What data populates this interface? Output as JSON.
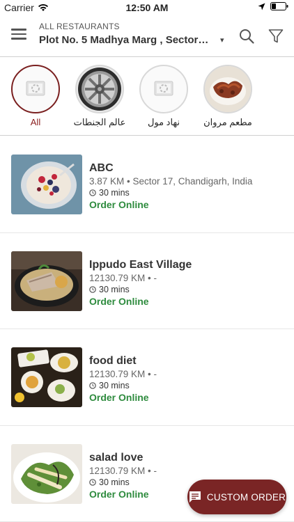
{
  "status_bar": {
    "carrier": "Carrier",
    "time": "12:50 AM"
  },
  "header": {
    "subtitle": "ALL RESTAURANTS",
    "location": "Plot No. 5 Madhya Marg , Sector…"
  },
  "categories": [
    {
      "label": "All",
      "icon": "placeholder-image-icon",
      "active": true
    },
    {
      "label": "عالم الجنطات",
      "icon": "wheel-rim-image"
    },
    {
      "label": "نهاد مول",
      "icon": "placeholder-image-icon"
    },
    {
      "label": "مطعم مروان",
      "icon": "food-plate-image"
    }
  ],
  "restaurants": [
    {
      "name": "ABC",
      "distance": "3.87 KM • Sector 17, Chandigarh, India",
      "time": "30 mins",
      "order": "Order Online",
      "image": "berry-bowl-photo"
    },
    {
      "name": "Ippudo East Village",
      "distance": "12130.79 KM • -",
      "time": "30 mins",
      "order": "Order Online",
      "image": "ramen-bowl-photo"
    },
    {
      "name": "food diet",
      "distance": "12130.79 KM • -",
      "time": "30 mins",
      "order": "Order Online",
      "image": "table-dishes-photo"
    },
    {
      "name": "salad love",
      "distance": "12130.79 KM • -",
      "time": "30 mins",
      "order": "Order Online",
      "image": "salad-plate-photo"
    }
  ],
  "fab": {
    "label": "CUSTOM ORDER",
    "color": "#7a2525"
  },
  "colors": {
    "accent": "#8b1d1d",
    "order_green": "#2e8b3e"
  }
}
